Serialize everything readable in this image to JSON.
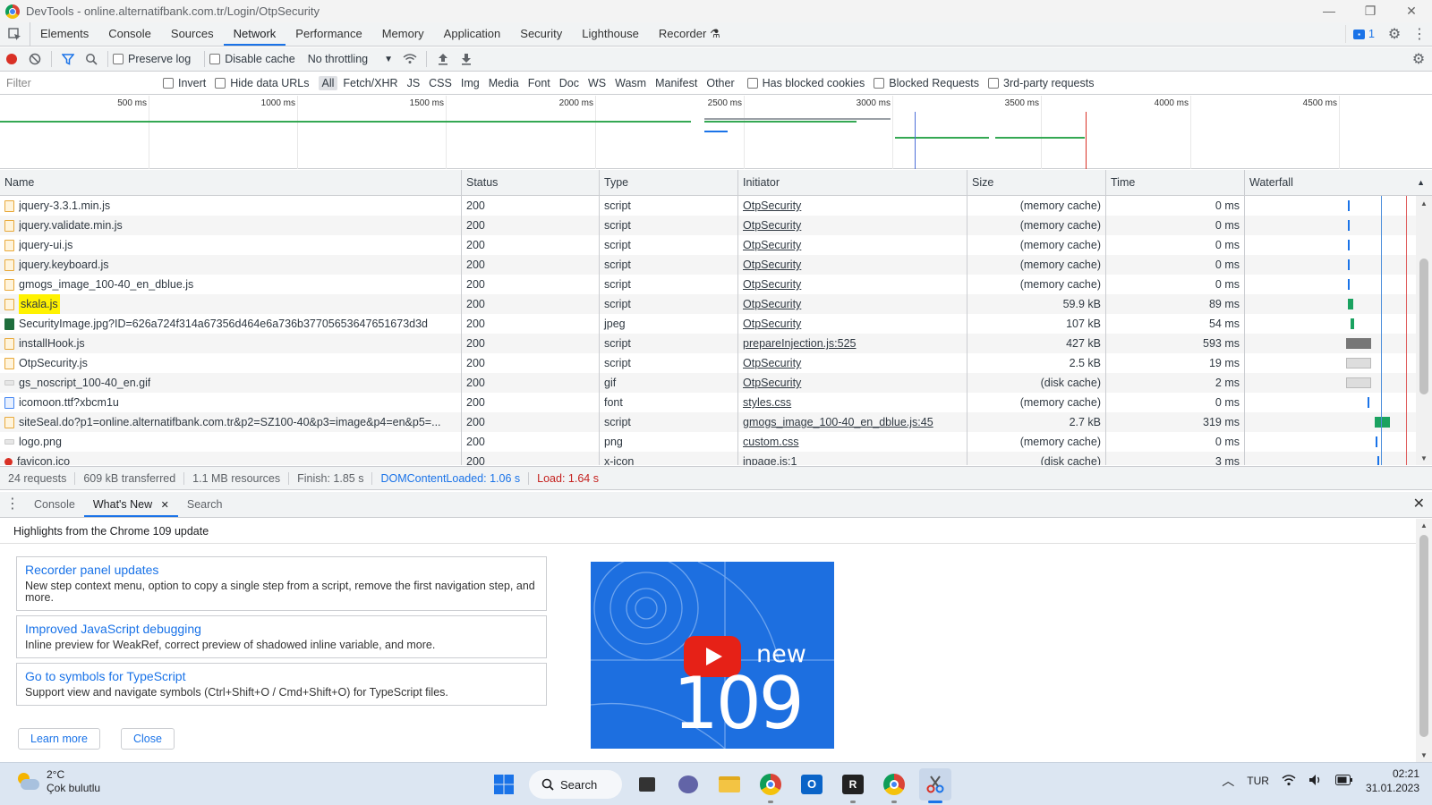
{
  "window": {
    "title": "DevTools - online.alternatifbank.com.tr/Login/OtpSecurity",
    "controls": [
      "—",
      "❐",
      "✕"
    ]
  },
  "tabs": [
    "Elements",
    "Console",
    "Sources",
    "Network",
    "Performance",
    "Memory",
    "Application",
    "Security",
    "Lighthouse",
    "Recorder ⚗"
  ],
  "active_tab": "Network",
  "issues_count": "1",
  "toolbar": {
    "preserve_log": "Preserve log",
    "disable_cache": "Disable cache",
    "throttling": "No throttling"
  },
  "filter": {
    "placeholder": "Filter",
    "invert": "Invert",
    "hide_data_urls": "Hide data URLs",
    "types": [
      "All",
      "Fetch/XHR",
      "JS",
      "CSS",
      "Img",
      "Media",
      "Font",
      "Doc",
      "WS",
      "Wasm",
      "Manifest",
      "Other"
    ],
    "active_type": "All",
    "has_blocked_cookies": "Has blocked cookies",
    "blocked_requests": "Blocked Requests",
    "third_party": "3rd-party requests"
  },
  "overview": {
    "ticks": [
      "500 ms",
      "1000 ms",
      "1500 ms",
      "2000 ms",
      "2500 ms",
      "3000 ms",
      "3500 ms",
      "4000 ms",
      "4500 ms"
    ]
  },
  "columns": [
    "Name",
    "Status",
    "Type",
    "Initiator",
    "Size",
    "Time",
    "Waterfall"
  ],
  "requests": [
    {
      "name": "jquery-3.3.1.min.js",
      "status": "200",
      "type": "script",
      "initiator": "OtpSecurity",
      "size": "(memory cache)",
      "time": "0 ms",
      "icon": "script-file-icon"
    },
    {
      "name": "jquery.validate.min.js",
      "status": "200",
      "type": "script",
      "initiator": "OtpSecurity",
      "size": "(memory cache)",
      "time": "0 ms",
      "icon": "script-file-icon"
    },
    {
      "name": "jquery-ui.js",
      "status": "200",
      "type": "script",
      "initiator": "OtpSecurity",
      "size": "(memory cache)",
      "time": "0 ms",
      "icon": "script-file-icon"
    },
    {
      "name": "jquery.keyboard.js",
      "status": "200",
      "type": "script",
      "initiator": "OtpSecurity",
      "size": "(memory cache)",
      "time": "0 ms",
      "icon": "script-file-icon"
    },
    {
      "name": "gmogs_image_100-40_en_dblue.js",
      "status": "200",
      "type": "script",
      "initiator": "OtpSecurity",
      "size": "(memory cache)",
      "time": "0 ms",
      "icon": "script-file-icon"
    },
    {
      "name": "skala.js",
      "status": "200",
      "type": "script",
      "initiator": "OtpSecurity",
      "size": "59.9 kB",
      "time": "89 ms",
      "icon": "script-file-icon",
      "highlighted": true
    },
    {
      "name": "SecurityImage.jpg?ID=626a724f314a67356d464e6a736b37705653647651673d3d",
      "status": "200",
      "type": "jpeg",
      "initiator": "OtpSecurity",
      "size": "107 kB",
      "time": "54 ms",
      "icon": "image-file-icon"
    },
    {
      "name": "installHook.js",
      "status": "200",
      "type": "script",
      "initiator": "prepareInjection.js:525",
      "size": "427 kB",
      "time": "593 ms",
      "icon": "script-file-icon"
    },
    {
      "name": "OtpSecurity.js",
      "status": "200",
      "type": "script",
      "initiator": "OtpSecurity",
      "size": "2.5 kB",
      "time": "19 ms",
      "icon": "script-file-icon"
    },
    {
      "name": "gs_noscript_100-40_en.gif",
      "status": "200",
      "type": "gif",
      "initiator": "OtpSecurity",
      "size": "(disk cache)",
      "time": "2 ms",
      "icon": "gif-file-icon"
    },
    {
      "name": "icomoon.ttf?xbcm1u",
      "status": "200",
      "type": "font",
      "initiator": "styles.css",
      "size": "(memory cache)",
      "time": "0 ms",
      "icon": "font-file-icon"
    },
    {
      "name": "siteSeal.do?p1=online.alternatifbank.com.tr&p2=SZ100-40&p3=image&p4=en&p5=...",
      "status": "200",
      "type": "script",
      "initiator": "gmogs_image_100-40_en_dblue.js:45",
      "size": "2.7 kB",
      "time": "319 ms",
      "icon": "script-file-icon"
    },
    {
      "name": "logo.png",
      "status": "200",
      "type": "png",
      "initiator": "custom.css",
      "size": "(memory cache)",
      "time": "0 ms",
      "icon": "gif-file-icon"
    },
    {
      "name": "favicon.ico",
      "status": "200",
      "type": "x-icon",
      "initiator": "inpage.js:1",
      "size": "(disk cache)",
      "time": "3 ms",
      "icon": "ico-file-icon"
    }
  ],
  "summary": {
    "requests": "24 requests",
    "transferred": "609 kB transferred",
    "resources": "1.1 MB resources",
    "finish": "Finish: 1.85 s",
    "dcl": "DOMContentLoaded: 1.06 s",
    "load": "Load: 1.64 s"
  },
  "drawer": {
    "tabs": [
      "Console",
      "What's New",
      "Search"
    ],
    "active_tab": "What's New",
    "headline": "Highlights from the Chrome 109 update",
    "cards": [
      {
        "title": "Recorder panel updates",
        "desc": "New step context menu, option to copy a single step from a script, remove the first navigation step, and more."
      },
      {
        "title": "Improved JavaScript debugging",
        "desc": "Inline preview for WeakRef, correct preview of shadowed inline variable, and more."
      },
      {
        "title": "Go to symbols for TypeScript",
        "desc": "Support view and navigate symbols (Ctrl+Shift+O / Cmd+Shift+O) for TypeScript files."
      }
    ],
    "learn_more": "Learn more",
    "close": "Close",
    "promo": {
      "word": "new",
      "number": "109"
    }
  },
  "taskbar": {
    "temperature": "2°C",
    "weather": "Çok bulutlu",
    "search": "Search",
    "language": "TUR",
    "time": "02:21",
    "date": "31.01.2023"
  }
}
